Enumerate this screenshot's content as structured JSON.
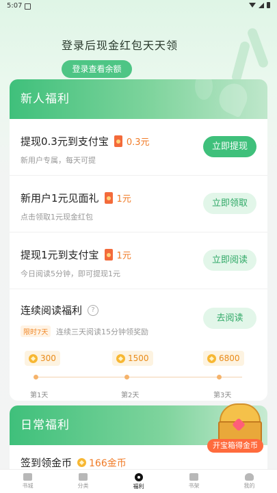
{
  "status_bar": {
    "time": "5:07"
  },
  "hero": {
    "title": "登录后现金红包天天领",
    "button": "登录查看余额"
  },
  "new_user_section": {
    "title": "新人福利",
    "tasks": [
      {
        "title": "提现0.3元到支付宝",
        "reward": "0.3元",
        "desc": "新用户专属，每天可提",
        "button": "立即提现"
      },
      {
        "title": "新用户1元见面礼",
        "reward": "1元",
        "desc": "点击领取1元现金红包",
        "button": "立即领取"
      },
      {
        "title": "提现1元到支付宝",
        "reward": "1元",
        "desc": "今日阅读5分钟，即可提现1元",
        "button": "立即阅读"
      }
    ],
    "streak": {
      "title": "连续阅读福利",
      "tag": "限时7天",
      "desc": "连续三天阅读15分钟领奖励",
      "button": "去阅读",
      "rewards": [
        {
          "coins": "300",
          "day": "第1天"
        },
        {
          "coins": "1500",
          "day": "第2天"
        },
        {
          "coins": "6800",
          "day": "第3天"
        }
      ]
    }
  },
  "daily_section": {
    "title": "日常福利",
    "first_task": {
      "title": "签到领金币",
      "coins": "166金币"
    }
  },
  "treasure_chest": {
    "label": "开宝箱得金币"
  },
  "bottom_nav": [
    {
      "label": "书城",
      "icon": "bookstore-icon"
    },
    {
      "label": "分类",
      "icon": "category-icon"
    },
    {
      "label": "福利",
      "icon": "welfare-icon"
    },
    {
      "label": "书架",
      "icon": "bookshelf-icon"
    },
    {
      "label": "我的",
      "icon": "profile-icon"
    }
  ]
}
